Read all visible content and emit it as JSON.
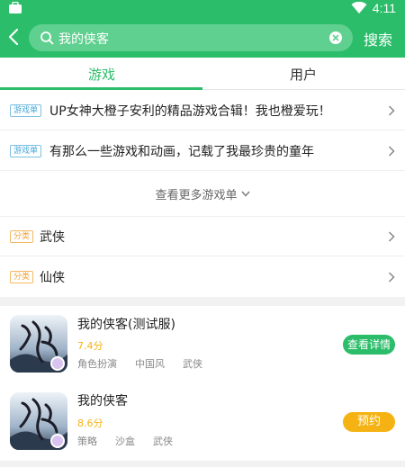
{
  "status_bar": {
    "time": "4:11"
  },
  "search": {
    "query": "我的侠客",
    "button": "搜索"
  },
  "tabs": [
    {
      "label": "游戏",
      "active": true
    },
    {
      "label": "用户",
      "active": false
    }
  ],
  "collections": [
    {
      "tag": "游戏单",
      "title": "UP女神大橙子安利的精品游戏合辑！我也橙爱玩！"
    },
    {
      "tag": "游戏单",
      "title": "有那么一些游戏和动画，记载了我最珍贵的童年"
    }
  ],
  "more_collections": "查看更多游戏单",
  "categories": [
    {
      "tag": "分类",
      "name": "武侠"
    },
    {
      "tag": "分类",
      "name": "仙侠"
    }
  ],
  "games": [
    {
      "name": "我的侠客(测试服)",
      "score": "7.4分",
      "tags": [
        "角色扮演",
        "中国风",
        "武侠"
      ],
      "action": "查看详情",
      "action_color": "#2bbd6a"
    },
    {
      "name": "我的侠客",
      "score": "8.6分",
      "tags": [
        "策略",
        "沙盒",
        "武侠"
      ],
      "action": "预约",
      "action_color": "#f5b313"
    }
  ],
  "colors": {
    "brand": "#2bbd6a",
    "score": "#f5b313",
    "tag_blue": "#4aa8d9",
    "tag_orange": "#f0a03a"
  }
}
